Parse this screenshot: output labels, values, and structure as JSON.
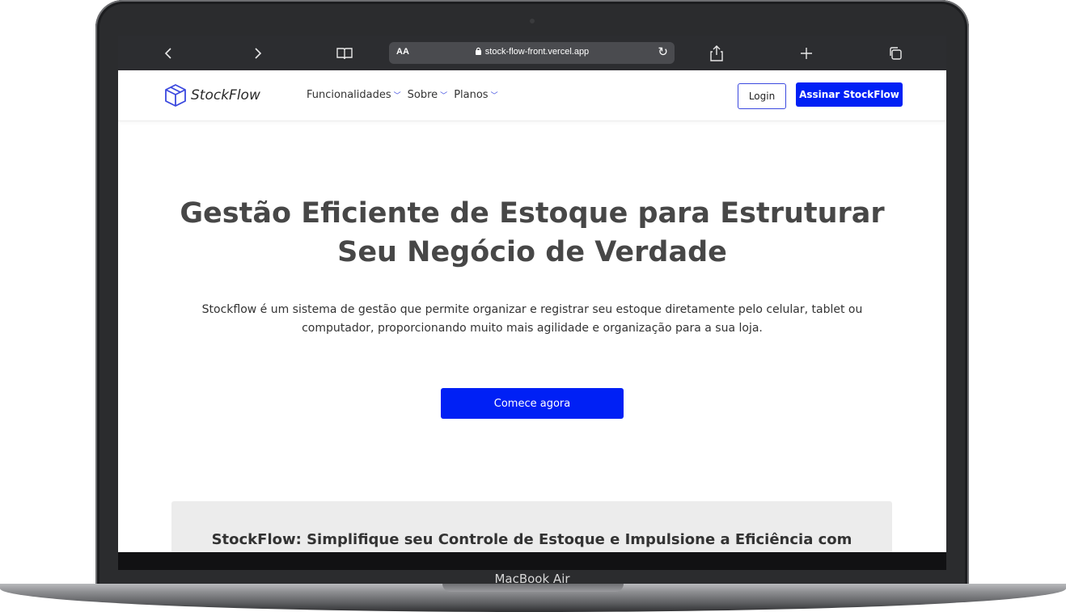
{
  "device": {
    "model_label": "MacBook Air"
  },
  "browser": {
    "back_icon": "chevron-left-icon",
    "forward_icon": "chevron-right-icon",
    "bookmarks_icon": "book-icon",
    "text_size_label": "AA",
    "url": "stock-flow-front.vercel.app",
    "reload_icon": "reload-icon",
    "share_icon": "share-icon",
    "new_tab_icon": "plus-icon",
    "tabs_icon": "tabs-icon"
  },
  "header": {
    "brand": "StockFlow",
    "nav": [
      {
        "label": "Funcionalidades"
      },
      {
        "label": "Sobre"
      },
      {
        "label": "Planos"
      }
    ],
    "login_label": "Login",
    "subscribe_label": "Assinar StockFlow"
  },
  "hero": {
    "title": "Gestão Eficiente de Estoque para Estruturar Seu Negócio de Verdade",
    "description": "Stockflow é um sistema de gestão que permite organizar e registrar seu estoque diretamente pelo celular, tablet ou computador, proporcionando muito mais agilidade e organização para a sua loja.",
    "cta_label": "Comece agora"
  },
  "feature": {
    "title": "StockFlow: Simplifique seu Controle de Estoque e Impulsione a Eficiência com"
  },
  "colors": {
    "primary": "#0020f5",
    "text_dark": "#474747",
    "browser_bar": "#2c2d30",
    "card_bg": "#ececec"
  }
}
